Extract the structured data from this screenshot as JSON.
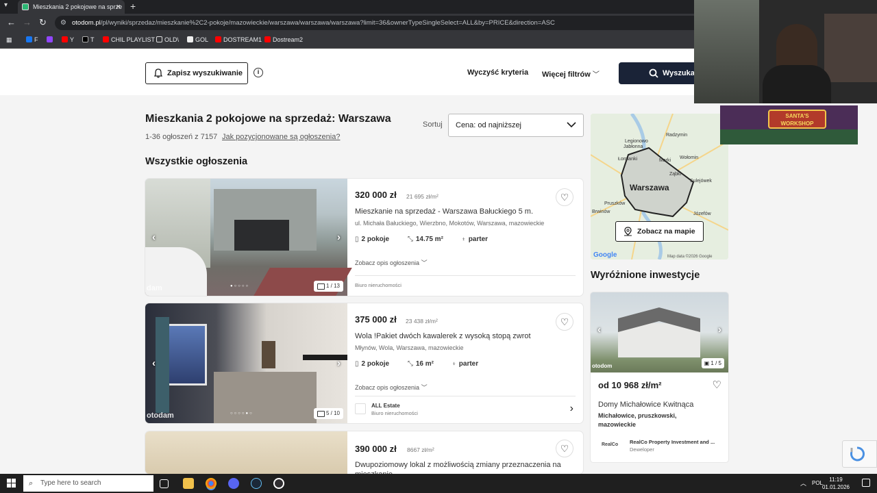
{
  "browser": {
    "tab_title": "Mieszkania 2 pokojowe na sprze",
    "url_host": "otodom.pl",
    "url_path": "/pl/wyniki/sprzedaz/mieszkanie%2C2-pokoje/mazowieckie/warszawa/warszawa/warszawa?limit=36&ownerTypeSingleSelect=ALL&by=PRICE&direction=ASC",
    "bookmarks": [
      "F",
      "",
      "Y",
      "T",
      "CHIL PLAYLIST",
      "OLD\\",
      "GOL",
      "DOSTREAM1",
      "Dostream2"
    ]
  },
  "header": {
    "save_search": "Zapisz wyszukiwanie",
    "clear_criteria": "Wyczyść kryteria",
    "more_filters": "Więcej filtrów",
    "search_button": "Wyszukaj"
  },
  "main": {
    "title": "Mieszkania 2 pokojowe na sprzedaż: Warszawa",
    "results_count": "1-36 ogłoszeń z 7157",
    "positioning_link": "Jak pozycjonowane są ogłoszenia?",
    "sort_label": "Sortuj",
    "sort_value": "Cena: od najniższej",
    "all_listings_heading": "Wszystkie ogłoszenia"
  },
  "listings": [
    {
      "price": "320 000 zł",
      "price_per_m2": "21 695 zł/m²",
      "title": "Mieszkanie na sprzedaż - Warszawa Bałuckiego 5 m.",
      "address": "ul. Michała Bałuckiego, Wierzbno, Mokotów, Warszawa, mazowieckie",
      "rooms": "2 pokoje",
      "area": "14.75 m²",
      "floor": "parter",
      "desc_toggle": "Zobacz opis ogłoszenia",
      "agency_type": "Biuro nieruchomości",
      "agency_name": "",
      "photo_count": "1 / 13",
      "watermark": "dam"
    },
    {
      "price": "375 000 zł",
      "price_per_m2": "23 438 zł/m²",
      "title": "Wola !Pakiet dwóch kawalerek z wysoką stopą zwrot",
      "address": "Młynów, Wola, Warszawa, mazowieckie",
      "rooms": "2 pokoje",
      "area": "16 m²",
      "floor": "parter",
      "desc_toggle": "Zobacz opis ogłoszenia",
      "agency_type": "Biuro nieruchomości",
      "agency_name": "ALL Estate",
      "photo_count": "5 / 10",
      "watermark": "otodam"
    },
    {
      "price": "390 000 zł",
      "price_per_m2": "8667 zł/m²",
      "title": "Dwupoziomowy lokal z możliwością zmiany przeznaczenia na mieszkanie"
    }
  ],
  "map": {
    "button": "Zobacz na mapie",
    "city": "Warszawa",
    "places": [
      "Radzymin",
      "Legionowo",
      "Jabłonna",
      "Marki",
      "Łomianki",
      "Wołomin",
      "Ząbki",
      "Sulejówek",
      "Pruszków",
      "Brwinów",
      "Józefów"
    ],
    "attribution": "Google",
    "copyright": "Map data ©2026 Google"
  },
  "featured": {
    "heading": "Wyróżnione inwestycje",
    "price": "od 10 968 zł/m²",
    "name": "Domy Michałowice Kwitnąca",
    "location": "Michałowice, pruszkowski, mazowieckie",
    "developer_logo": "RealCo",
    "developer": "RealCo Property Investment and ...",
    "developer_type": "Deweloper",
    "photo_count": "1 / 5",
    "watermark": "otodom"
  },
  "overlay_text": "SANTA'S WORKSHOP",
  "taskbar": {
    "search_placeholder": "Type here to search",
    "lang": "POL",
    "time": "11:19",
    "date": "01.01.2026"
  }
}
